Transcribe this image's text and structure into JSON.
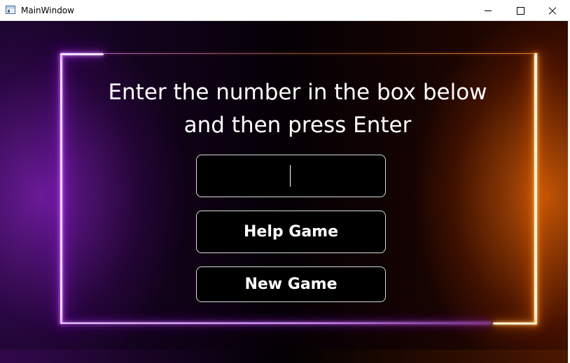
{
  "window": {
    "title": "MainWindow",
    "app_icon": "window-app-icon",
    "controls": [
      "minimize-icon",
      "maximize-icon",
      "close-icon"
    ]
  },
  "prompt": {
    "line1": "Enter the number in the box below",
    "line2": "and then press Enter"
  },
  "number_input": {
    "value": "",
    "placeholder": ""
  },
  "buttons": {
    "help": "Help Game",
    "new": "New Game"
  },
  "colors": {
    "neon_left": "#c13cff",
    "neon_right": "#ff7000",
    "text": "#ffffff",
    "control_bg": "#000000",
    "control_border": "#d9d9d9"
  }
}
